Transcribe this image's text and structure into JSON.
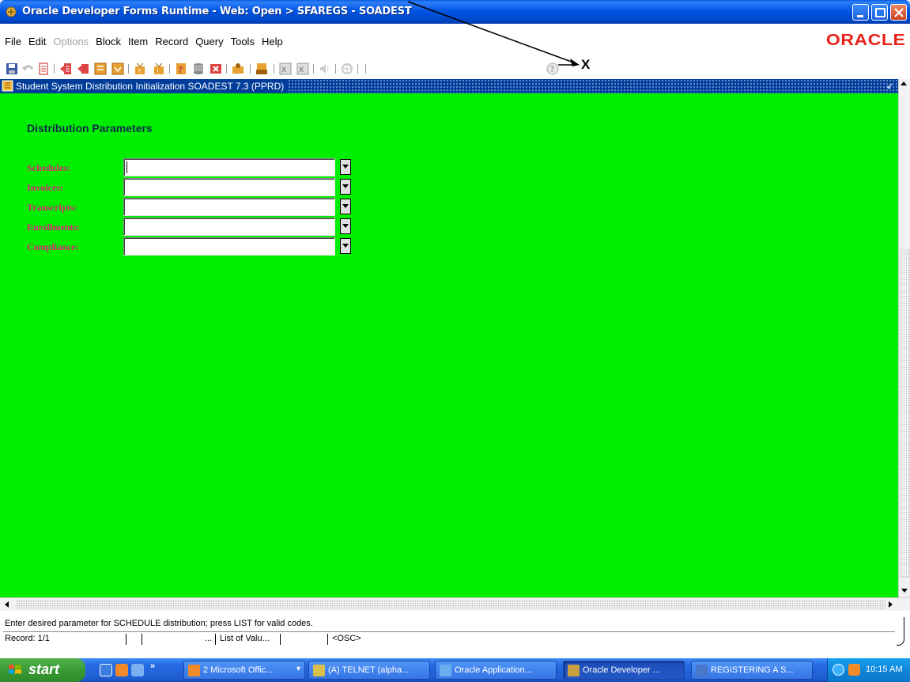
{
  "window": {
    "title": "Oracle Developer Forms Runtime - Web:  Open > SFAREGS - SOADEST"
  },
  "menu": {
    "items": [
      "File",
      "Edit",
      "Options",
      "Block",
      "Item",
      "Record",
      "Query",
      "Tools",
      "Help"
    ],
    "disabled": [
      "Options"
    ],
    "brand": "ORACLE"
  },
  "toolbar": {
    "icons": [
      "save-icon",
      "rollback-icon",
      "print-icon",
      "previous-block-icon",
      "previous-record-icon",
      "next-record-icon",
      "next-block-icon",
      "enter-query-icon",
      "execute-query-icon",
      "insert-record-icon",
      "remove-record-icon",
      "clear-record-icon",
      "copy-icon",
      "list-of-values-icon",
      "edit-icon",
      "exit-icon",
      "help-icon",
      "speaker-icon",
      "options-icon",
      "help-question-icon"
    ],
    "annotation": "X"
  },
  "form": {
    "title": "Student System Distribution Initialization  SOADEST  7.3  (PPRD)",
    "section_title": "Distribution Parameters",
    "fields": [
      {
        "label": "Schedules:",
        "value": ""
      },
      {
        "label": "Invoices:",
        "value": ""
      },
      {
        "label": "Transcripts:",
        "value": ""
      },
      {
        "label": "Enrollments:",
        "value": ""
      },
      {
        "label": "Compliance:",
        "value": ""
      }
    ],
    "canvas_color": "#00ee00",
    "label_color": "#e0257a"
  },
  "status": {
    "hint": "Enter desired parameter for SCHEDULE distribution; press LIST for valid codes.",
    "record": "Record: 1/1",
    "ellipsis": "...",
    "lov": "List of Valu...",
    "osc": "<OSC>"
  },
  "taskbar": {
    "start": "start",
    "tasks": [
      {
        "label": "2 Microsoft Offic...",
        "icon_color": "#f28a2a",
        "has_arrow": true
      },
      {
        "label": "(A) TELNET (alpha...",
        "icon_color": "#d9c04a",
        "has_arrow": false
      },
      {
        "label": "Oracle Application...",
        "icon_color": "#6aaef0",
        "has_arrow": false
      },
      {
        "label": "Oracle Developer ...",
        "icon_color": "#c9a040",
        "has_arrow": false,
        "active": true
      },
      {
        "label": "REGISTERING A S...",
        "icon_color": "#4a78c8",
        "has_arrow": false
      }
    ],
    "clock": "10:15 AM"
  }
}
